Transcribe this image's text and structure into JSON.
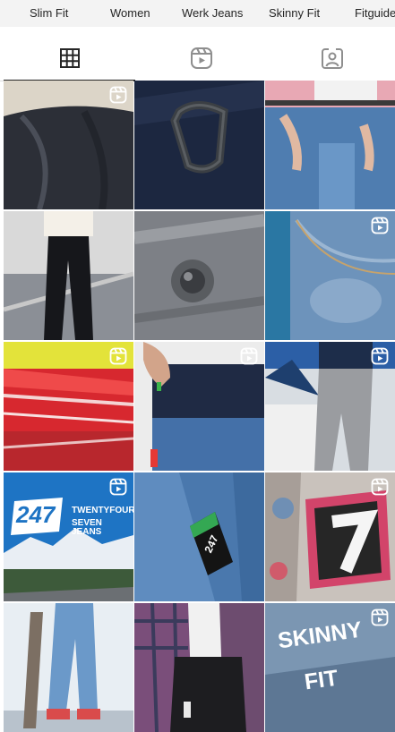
{
  "highlights": [
    {
      "label": "Slim Fit"
    },
    {
      "label": "Women"
    },
    {
      "label": "Werk Jeans"
    },
    {
      "label": "Skinny Fit"
    },
    {
      "label": "Fitguide"
    }
  ],
  "tabs": [
    {
      "icon": "grid-icon",
      "active": true
    },
    {
      "icon": "reels-icon",
      "active": false
    },
    {
      "icon": "tagged-icon",
      "active": false
    }
  ],
  "posts": [
    {
      "reel": true,
      "subject": "dark jeans close-up"
    },
    {
      "reel": false,
      "subject": "denim belt loop with D-ring"
    },
    {
      "reel": false,
      "subject": "pink jacket and jeans"
    },
    {
      "reel": false,
      "subject": "black skinny jeans standing"
    },
    {
      "reel": false,
      "subject": "grey denim rivet button"
    },
    {
      "reel": true,
      "subject": "light wash denim pocket"
    },
    {
      "reel": true,
      "subject": "red ceiling motion"
    },
    {
      "reel": true,
      "subject": "hand in jeans pocket"
    },
    {
      "reel": true,
      "subject": "grey jeans on car"
    },
    {
      "reel": true,
      "subject": "247 twentyfour seven jeans banner",
      "brand_num": "247",
      "brand_line1": "TWENTYFOUR",
      "brand_line2": "SEVEN JEANS"
    },
    {
      "reel": false,
      "subject": "247 label on jeans",
      "tag_text": "247"
    },
    {
      "reel": true,
      "subject": "graffiti with number 7"
    },
    {
      "reel": false,
      "subject": "skateboard and jeans"
    },
    {
      "reel": false,
      "subject": "plaid shirt and black jeans"
    },
    {
      "reel": true,
      "subject": "skinny fit title",
      "title_line1": "SKINNY",
      "title_line2": "FIT"
    }
  ]
}
